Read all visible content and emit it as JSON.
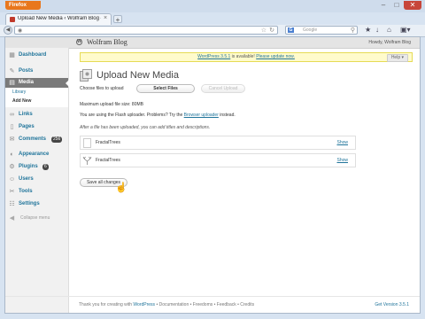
{
  "browser": {
    "app_button": "Firefox",
    "tab_title": "Upload New Media ‹ Wolfram Blog — W...",
    "new_tab": "+",
    "search_placeholder": "Google",
    "search_engine_letter": "G"
  },
  "admin": {
    "site_name": "Wolfram Blog",
    "howdy": "Howdy, Wolfram Blog"
  },
  "sidebar": {
    "items": [
      {
        "label": "Dashboard",
        "icon": "dashboard-icon"
      },
      {
        "label": "Posts",
        "icon": "posts-icon"
      },
      {
        "label": "Media",
        "icon": "media-icon"
      },
      {
        "label": "Links",
        "icon": "links-icon"
      },
      {
        "label": "Pages",
        "icon": "pages-icon"
      },
      {
        "label": "Comments",
        "icon": "comments-icon",
        "badge": "256"
      },
      {
        "label": "Appearance",
        "icon": "appearance-icon"
      },
      {
        "label": "Plugins",
        "icon": "plugins-icon",
        "badge": "6"
      },
      {
        "label": "Users",
        "icon": "users-icon"
      },
      {
        "label": "Tools",
        "icon": "tools-icon"
      },
      {
        "label": "Settings",
        "icon": "settings-icon"
      }
    ],
    "media_sub": [
      "Library",
      "Add New"
    ],
    "collapse": "Collapse menu"
  },
  "main": {
    "update_nag_version": "WordPress 3.5.1",
    "update_nag_mid": " is available! ",
    "update_nag_link": "Please update now.",
    "help_button": "Help ▾",
    "title": "Upload New Media",
    "choose_label": "Choose files to upload",
    "select_files": "Select Files",
    "cancel_upload": "Cancel Upload",
    "max_size": "Maximum upload file size: 80MB",
    "flash_prefix": "You are using the Flash uploader. Problems? Try the ",
    "browser_uploader": "Browser uploader",
    "flash_suffix": " instead.",
    "after_upload": "After a file has been uploaded, you can add titles and descriptions.",
    "rows": [
      {
        "name": "FractalTrees",
        "show": "Show"
      },
      {
        "name": "FractalTrees",
        "show": "Show"
      }
    ],
    "save_button": "Save all changes"
  },
  "footer": {
    "thanks_prefix": "Thank you for creating with ",
    "wordpress": "WordPress",
    "links": " • Documentation • Freedoms • Feedback • Credits",
    "version": "Get Version 3.5.1"
  }
}
